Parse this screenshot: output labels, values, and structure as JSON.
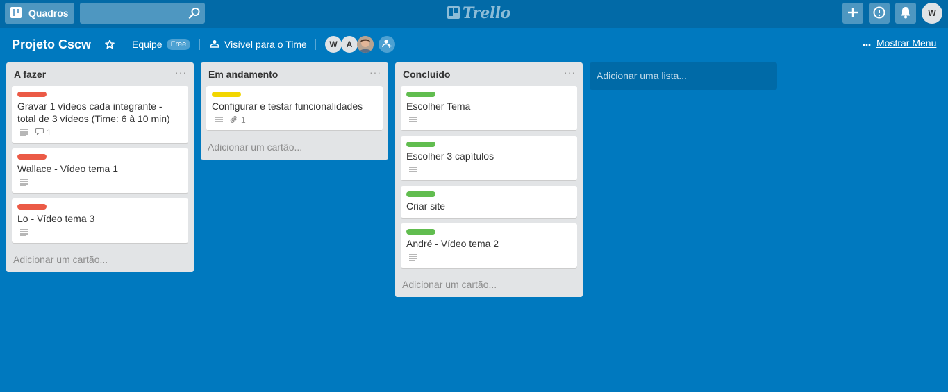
{
  "header": {
    "boards_label": "Quadros",
    "search_value": "",
    "logo_text": "Trello",
    "user_initial": "W"
  },
  "board": {
    "title": "Projeto Cscw",
    "team_label": "Equipe",
    "team_badge": "Free",
    "visibility_label": "Visível para o Time",
    "members": [
      "W",
      "A"
    ],
    "show_menu_label": "Mostrar Menu"
  },
  "colors": {
    "board_bg": "#0079bf",
    "label_red": "#eb5a46",
    "label_yellow": "#f2d600",
    "label_green": "#61bd4f"
  },
  "lists": [
    {
      "title": "A fazer",
      "add_card_label": "Adicionar um cartão...",
      "cards": [
        {
          "label_color": "red",
          "title": "Gravar 1 vídeos cada integrante - total de 3 vídeos (Time: 6 à 10 min)",
          "has_description": true,
          "comments": "1"
        },
        {
          "label_color": "red",
          "title": "Wallace - Vídeo tema 1",
          "has_description": true
        },
        {
          "label_color": "red",
          "title": "Lo - Vídeo tema 3",
          "has_description": true
        }
      ]
    },
    {
      "title": "Em andamento",
      "add_card_label": "Adicionar um cartão...",
      "cards": [
        {
          "label_color": "yellow",
          "title": "Configurar e testar funcionalidades",
          "has_description": true,
          "attachments": "1"
        }
      ]
    },
    {
      "title": "Concluído",
      "add_card_label": "Adicionar um cartão...",
      "cards": [
        {
          "label_color": "green",
          "title": "Escolher Tema",
          "has_description": true
        },
        {
          "label_color": "green",
          "title": "Escolher 3 capítulos",
          "has_description": true
        },
        {
          "label_color": "green",
          "title": "Criar site",
          "has_description": false
        },
        {
          "label_color": "green",
          "title": "André - Vídeo tema 2",
          "has_description": true
        }
      ]
    }
  ],
  "add_list_label": "Adicionar uma lista..."
}
